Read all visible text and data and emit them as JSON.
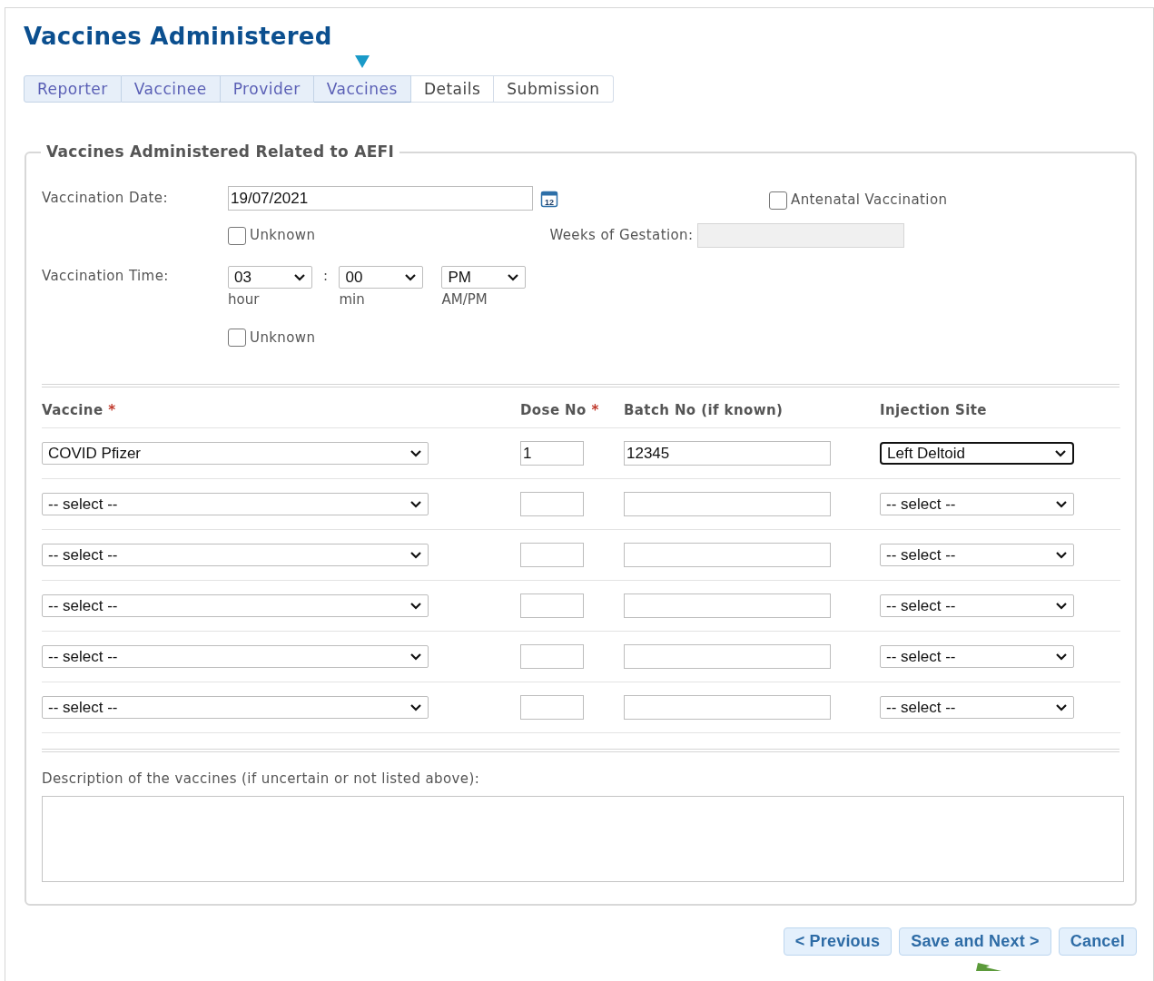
{
  "title": "Vaccines Administered",
  "tabs": [
    {
      "label": "Reporter",
      "visited": true,
      "selected": false
    },
    {
      "label": "Vaccinee",
      "visited": true,
      "selected": false
    },
    {
      "label": "Provider",
      "visited": true,
      "selected": false
    },
    {
      "label": "Vaccines",
      "visited": true,
      "selected": true
    },
    {
      "label": "Details",
      "visited": false,
      "selected": false
    },
    {
      "label": "Submission",
      "visited": false,
      "selected": false
    }
  ],
  "section": {
    "legend": "Vaccines Administered Related to AEFI",
    "vaccination_date": {
      "label": "Vaccination Date:",
      "value": "19/07/2021",
      "calendar_day": "12",
      "unknown": {
        "label": "Unknown",
        "checked": false
      }
    },
    "antenatal": {
      "label": "Antenatal Vaccination",
      "checked": false
    },
    "weeks_of_gestation": {
      "label": "Weeks of Gestation:",
      "disabled": true
    },
    "vaccination_time": {
      "label": "Vaccination Time:",
      "separator": ":",
      "parts": [
        {
          "value": "03",
          "caption": "hour"
        },
        {
          "value": "00",
          "caption": "min"
        },
        {
          "value": "PM",
          "caption": "AM/PM"
        }
      ],
      "unknown": {
        "label": "Unknown",
        "checked": false
      }
    },
    "vaccines_table": {
      "columns": [
        {
          "label": "Vaccine",
          "required": true
        },
        {
          "label": "Dose No",
          "required": true
        },
        {
          "label": "Batch No (if known)",
          "required": false
        },
        {
          "label": "Injection Site",
          "required": false
        }
      ],
      "required_mark": "*",
      "rows": [
        {
          "vaccine": "COVID Pfizer",
          "dose": "1",
          "batch": "12345",
          "site": "Left Deltoid",
          "site_focused": true
        },
        {
          "vaccine": "-- select --",
          "site": "-- select --",
          "site_focused": false
        },
        {
          "vaccine": "-- select --",
          "site": "-- select --",
          "site_focused": false
        },
        {
          "vaccine": "-- select --",
          "site": "-- select --",
          "site_focused": false
        },
        {
          "vaccine": "-- select --",
          "site": "-- select --",
          "site_focused": false
        },
        {
          "vaccine": "-- select --",
          "site": "-- select --",
          "site_focused": false
        }
      ]
    },
    "description": {
      "label": "Description of the vaccines (if uncertain or not listed above):"
    }
  },
  "buttons": [
    {
      "label": "< Previous"
    },
    {
      "label": "Save and Next >"
    },
    {
      "label": "Cancel"
    }
  ]
}
